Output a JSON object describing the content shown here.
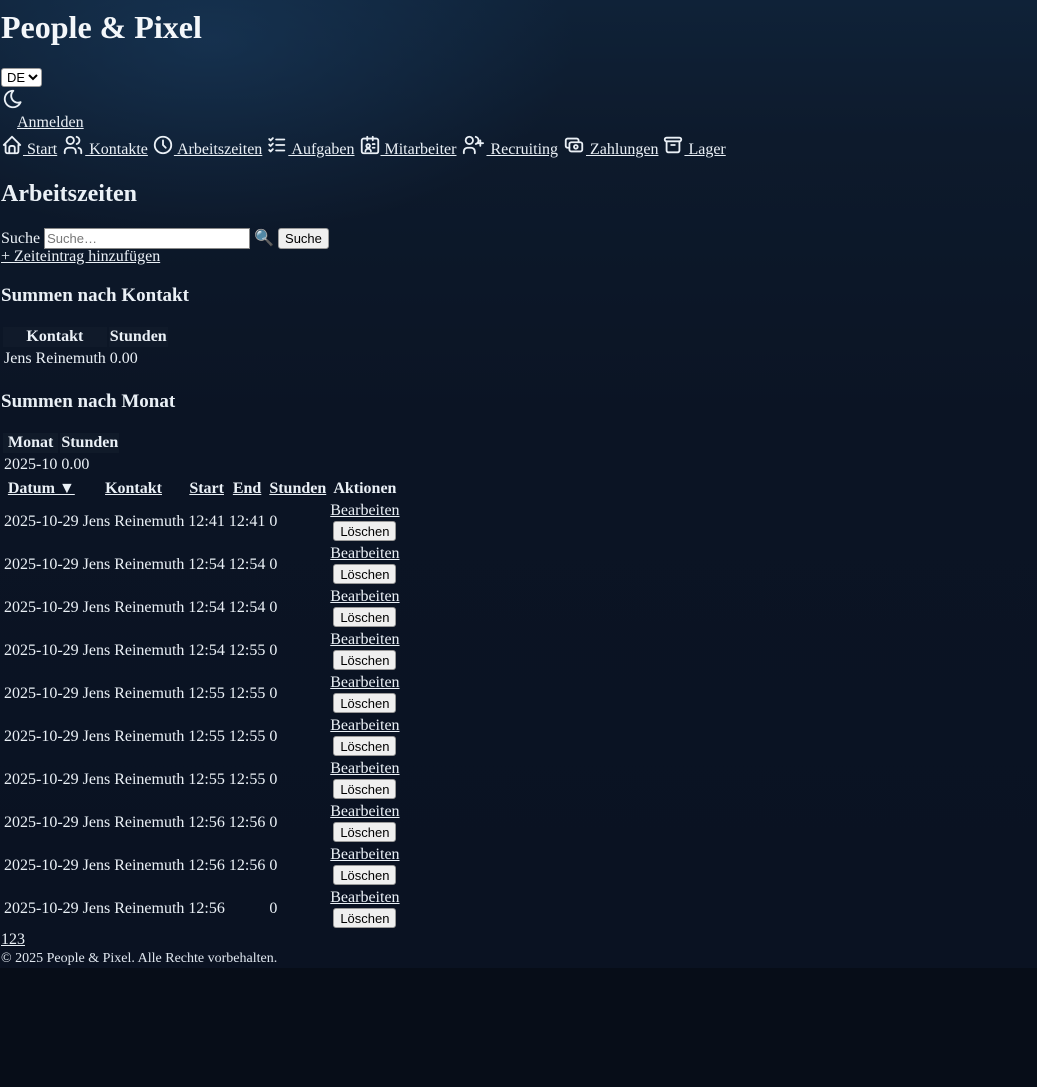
{
  "header": {
    "brand": "People & Pixel",
    "language": {
      "selected": "DE",
      "options": [
        "DE"
      ]
    },
    "theme_icon": "moon-icon",
    "login_label": "Anmelden"
  },
  "nav": {
    "items": [
      {
        "label": " Start",
        "icon": "home-icon"
      },
      {
        "label": " Kontakte",
        "icon": "users-icon"
      },
      {
        "label": " Arbeitszeiten",
        "icon": "clock-icon"
      },
      {
        "label": " Aufgaben",
        "icon": "checklist-icon"
      },
      {
        "label": " Mitarbeiter",
        "icon": "id-card-icon"
      },
      {
        "label": " Recruiting",
        "icon": "user-plus-icon"
      },
      {
        "label": " Zahlungen",
        "icon": "cash-icon"
      },
      {
        "label": " Lager",
        "icon": "archive-icon"
      }
    ]
  },
  "page": {
    "title": "Arbeitszeiten",
    "search_label": "Suche",
    "search_placeholder": "Suche…",
    "search_icon": "🔍",
    "search_button": "Suche",
    "add_link": "+ Zeiteintrag hinzufügen"
  },
  "sum_by_contact": {
    "title": "Summen nach Kontakt",
    "headers": [
      "Kontakt",
      "Stunden"
    ],
    "rows": [
      [
        "Jens Reinemuth",
        "0.00"
      ]
    ]
  },
  "sum_by_month": {
    "title": "Summen nach Monat",
    "headers": [
      "Monat",
      "Stunden"
    ],
    "rows": [
      [
        "2025-10",
        "0.00"
      ]
    ]
  },
  "entries": {
    "headers": {
      "date": "Datum ▼",
      "contact": "Kontakt",
      "start": "Start",
      "end": "End",
      "hours": "Stunden",
      "actions": "Aktionen"
    },
    "edit_label": "Bearbeiten",
    "delete_label": "Löschen",
    "rows": [
      [
        "2025-10-29",
        "Jens Reinemuth",
        "12:41",
        "12:41",
        "0"
      ],
      [
        "2025-10-29",
        "Jens Reinemuth",
        "12:54",
        "12:54",
        "0"
      ],
      [
        "2025-10-29",
        "Jens Reinemuth",
        "12:54",
        "12:54",
        "0"
      ],
      [
        "2025-10-29",
        "Jens Reinemuth",
        "12:54",
        "12:55",
        "0"
      ],
      [
        "2025-10-29",
        "Jens Reinemuth",
        "12:55",
        "12:55",
        "0"
      ],
      [
        "2025-10-29",
        "Jens Reinemuth",
        "12:55",
        "12:55",
        "0"
      ],
      [
        "2025-10-29",
        "Jens Reinemuth",
        "12:55",
        "12:55",
        "0"
      ],
      [
        "2025-10-29",
        "Jens Reinemuth",
        "12:56",
        "12:56",
        "0"
      ],
      [
        "2025-10-29",
        "Jens Reinemuth",
        "12:56",
        "12:56",
        "0"
      ],
      [
        "2025-10-29",
        "Jens Reinemuth",
        "12:56",
        "",
        "0"
      ]
    ]
  },
  "pagination": {
    "pages": [
      "1",
      "2",
      "3"
    ]
  },
  "footer": {
    "text": "© 2025 People & Pixel. Alle Rechte vorbehalten."
  }
}
